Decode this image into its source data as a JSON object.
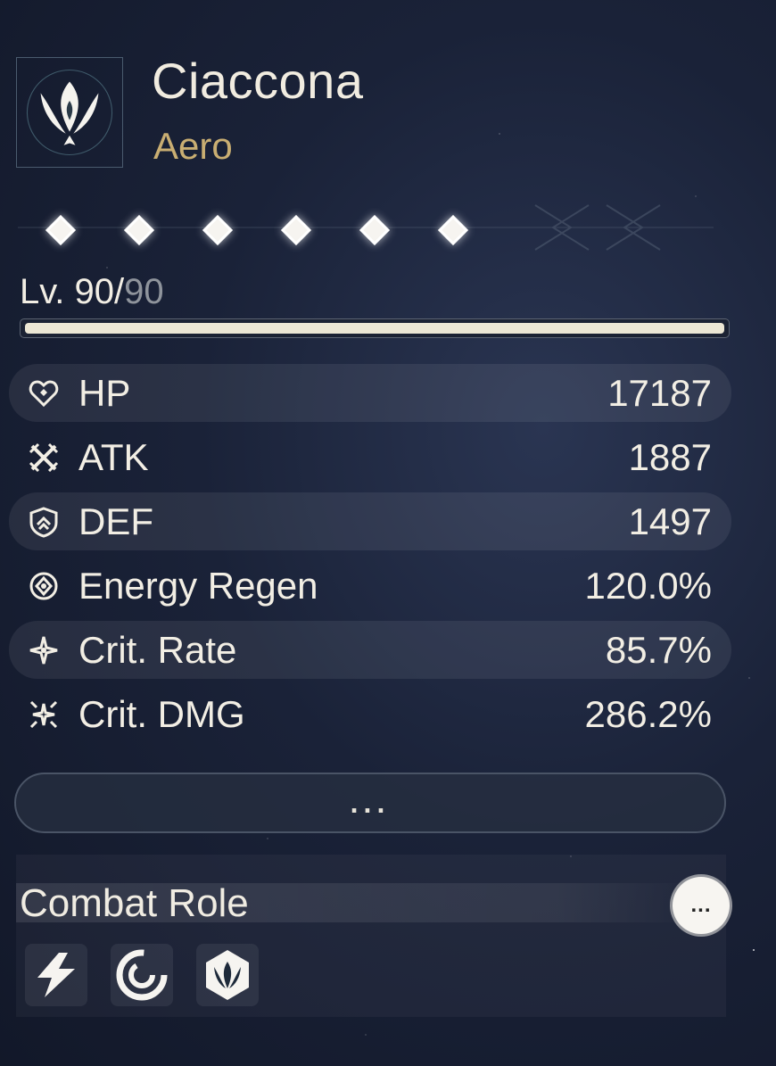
{
  "character": {
    "name": "Ciaccona",
    "element": "Aero",
    "element_color": "#c9ae72",
    "emblem_icon": "aero-emblem-icon",
    "sequence_nodes": 6
  },
  "level": {
    "current": "90",
    "separator": "/",
    "max": "90",
    "prefix": "Lv. ",
    "progress": 1.0
  },
  "stats": [
    {
      "icon": "heart-icon",
      "label": "HP",
      "value": "17187"
    },
    {
      "icon": "crossed-swords-icon",
      "label": "ATK",
      "value": "1887"
    },
    {
      "icon": "shield-icon",
      "label": "DEF",
      "value": "1497"
    },
    {
      "icon": "energy-regen-icon",
      "label": "Energy Regen",
      "value": "120.0%"
    },
    {
      "icon": "crit-rate-icon",
      "label": "Crit. Rate",
      "value": "85.7%"
    },
    {
      "icon": "crit-dmg-icon",
      "label": "Crit. DMG",
      "value": "286.2%"
    }
  ],
  "more_button_label": "...",
  "combat_role": {
    "title": "Combat Role",
    "details_button_label": "...",
    "icons": [
      "lightning-role-icon",
      "swirl-role-icon",
      "aero-role-icon"
    ]
  }
}
